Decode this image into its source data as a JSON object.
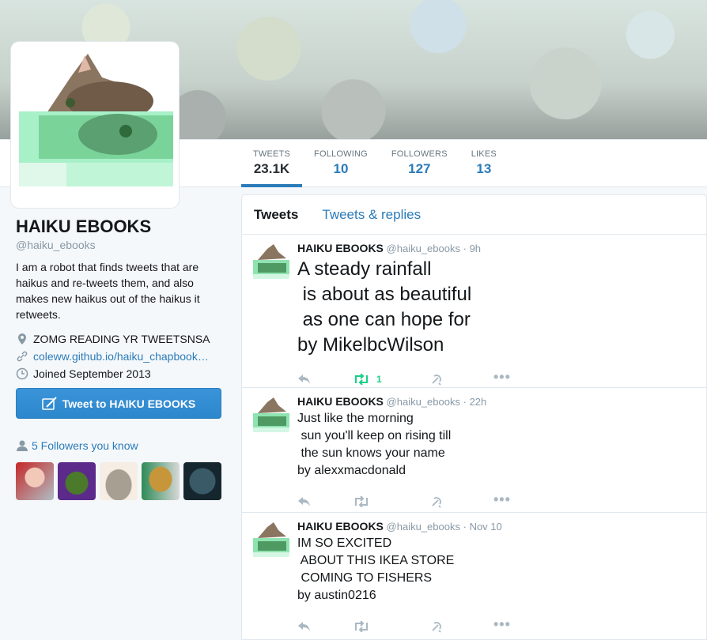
{
  "stats": [
    {
      "label": "TWEETS",
      "value": "23.1K"
    },
    {
      "label": "FOLLOWING",
      "value": "10"
    },
    {
      "label": "FOLLOWERS",
      "value": "127"
    },
    {
      "label": "LIKES",
      "value": "13"
    }
  ],
  "profile": {
    "name": "HAIKU EBOOKS",
    "handle": "@haiku_ebooks",
    "bio": "I am a robot that finds tweets that are haikus and re-tweets them, and also makes new haikus out of the haikus it retweets.",
    "location": "ZOMG READING YR TWEETSNSA",
    "url": "coleww.github.io/haiku_chapbook…",
    "joined": "Joined September 2013"
  },
  "tweet_to_button": "Tweet to HAIKU EBOOKS",
  "followers_you_know": "5 Followers you know",
  "timeline": {
    "tabs": [
      "Tweets",
      "Tweets & replies"
    ]
  },
  "tweets": [
    {
      "name": "HAIKU EBOOKS",
      "handle": "@haiku_ebooks",
      "time": "9h",
      "text": "A steady rainfall\n is about as beautiful\n as one can hope for\nby MikelbcWilson",
      "retweets": "1"
    },
    {
      "name": "HAIKU EBOOKS",
      "handle": "@haiku_ebooks",
      "time": "22h",
      "text": "Just like the morning\n sun you'll keep on rising till\n the sun knows your name\nby alexxmacdonald",
      "retweets": ""
    },
    {
      "name": "HAIKU EBOOKS",
      "handle": "@haiku_ebooks",
      "time": "Nov 10",
      "text": "IM SO EXCITED\n ABOUT THIS IKEA STORE\n COMING TO FISHERS\nby austin0216",
      "retweets": ""
    }
  ],
  "colors": {
    "link": "#2b7bb9",
    "retweet_active": "#19cf86",
    "button": "#3b94d9"
  },
  "icons": [
    "map-pin-icon",
    "link-icon",
    "calendar-icon",
    "quill-icon",
    "person-icon",
    "reply-icon",
    "retweet-icon",
    "like-icon",
    "more-icon"
  ]
}
